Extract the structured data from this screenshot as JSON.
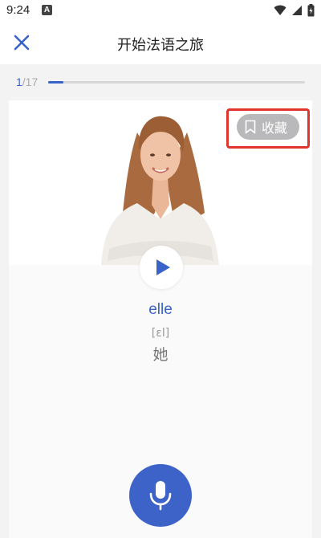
{
  "status_bar": {
    "time": "9:24",
    "notification_badge": "A",
    "icons": [
      "wifi-icon",
      "signal-icon",
      "battery-charging-icon"
    ]
  },
  "header": {
    "title": "开始法语之旅",
    "close_icon": "close-icon"
  },
  "progress": {
    "current": "1",
    "total": "/17",
    "fraction": 0.0588
  },
  "card": {
    "favorite_label": "收藏",
    "favorite_icon": "bookmark-icon",
    "play_icon": "play-icon",
    "word": "elle",
    "phonetic": "[ɛl]",
    "meaning": "她",
    "mic_icon": "microphone-icon"
  },
  "colors": {
    "accent": "#3a63c9",
    "highlight": "#e0352b",
    "favorite_bg": "#b9b9bb"
  }
}
